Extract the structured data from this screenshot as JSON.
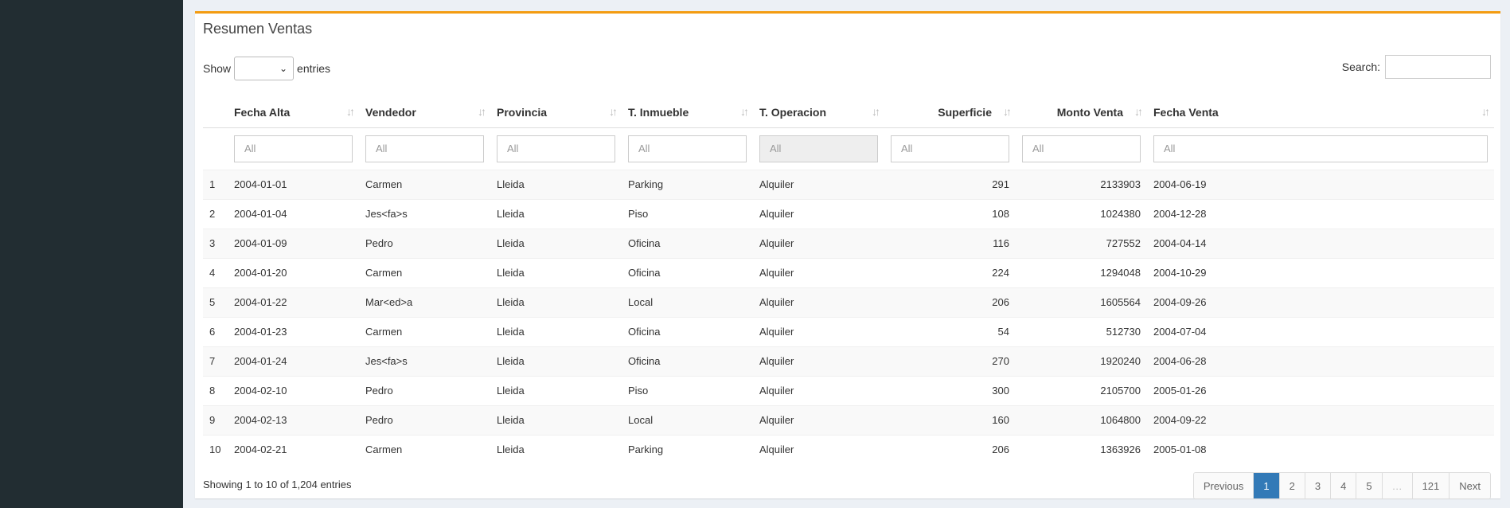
{
  "box": {
    "title": "Resumen Ventas"
  },
  "controls": {
    "show_label": "Show",
    "entries_label": "entries",
    "search_label": "Search:"
  },
  "columns": [
    {
      "label": ""
    },
    {
      "label": "Fecha Alta"
    },
    {
      "label": "Vendedor"
    },
    {
      "label": "Provincia"
    },
    {
      "label": "T. Inmueble"
    },
    {
      "label": "T. Operacion"
    },
    {
      "label": "Superficie"
    },
    {
      "label": "Monto Venta"
    },
    {
      "label": "Fecha Venta"
    }
  ],
  "filters": [
    "All",
    "All",
    "All",
    "All",
    "All",
    "All",
    "All",
    "All"
  ],
  "rows": [
    [
      "1",
      "2004-01-01",
      "Carmen",
      "Lleida",
      "Parking",
      "Alquiler",
      "291",
      "2133903",
      "2004-06-19"
    ],
    [
      "2",
      "2004-01-04",
      "Jes<fa>s",
      "Lleida",
      "Piso",
      "Alquiler",
      "108",
      "1024380",
      "2004-12-28"
    ],
    [
      "3",
      "2004-01-09",
      "Pedro",
      "Lleida",
      "Oficina",
      "Alquiler",
      "116",
      "727552",
      "2004-04-14"
    ],
    [
      "4",
      "2004-01-20",
      "Carmen",
      "Lleida",
      "Oficina",
      "Alquiler",
      "224",
      "1294048",
      "2004-10-29"
    ],
    [
      "5",
      "2004-01-22",
      "Mar<ed>a",
      "Lleida",
      "Local",
      "Alquiler",
      "206",
      "1605564",
      "2004-09-26"
    ],
    [
      "6",
      "2004-01-23",
      "Carmen",
      "Lleida",
      "Oficina",
      "Alquiler",
      "54",
      "512730",
      "2004-07-04"
    ],
    [
      "7",
      "2004-01-24",
      "Jes<fa>s",
      "Lleida",
      "Oficina",
      "Alquiler",
      "270",
      "1920240",
      "2004-06-28"
    ],
    [
      "8",
      "2004-02-10",
      "Pedro",
      "Lleida",
      "Piso",
      "Alquiler",
      "300",
      "2105700",
      "2005-01-26"
    ],
    [
      "9",
      "2004-02-13",
      "Pedro",
      "Lleida",
      "Local",
      "Alquiler",
      "160",
      "1064800",
      "2004-09-22"
    ],
    [
      "10",
      "2004-02-21",
      "Carmen",
      "Lleida",
      "Parking",
      "Alquiler",
      "206",
      "1363926",
      "2005-01-08"
    ]
  ],
  "footer": {
    "info": "Showing 1 to 10 of 1,204 entries"
  },
  "pagination": {
    "previous": "Previous",
    "pages": [
      "1",
      "2",
      "3",
      "4",
      "5",
      "…",
      "121"
    ],
    "next": "Next",
    "active": "1"
  },
  "icons": {
    "sort": "sort-icon",
    "chevron": "chevron-down-icon",
    "cursor": "cursor-icon"
  },
  "colors": {
    "accent": "#f39c12",
    "sidebar": "#222d32",
    "active_page": "#337ab7"
  }
}
